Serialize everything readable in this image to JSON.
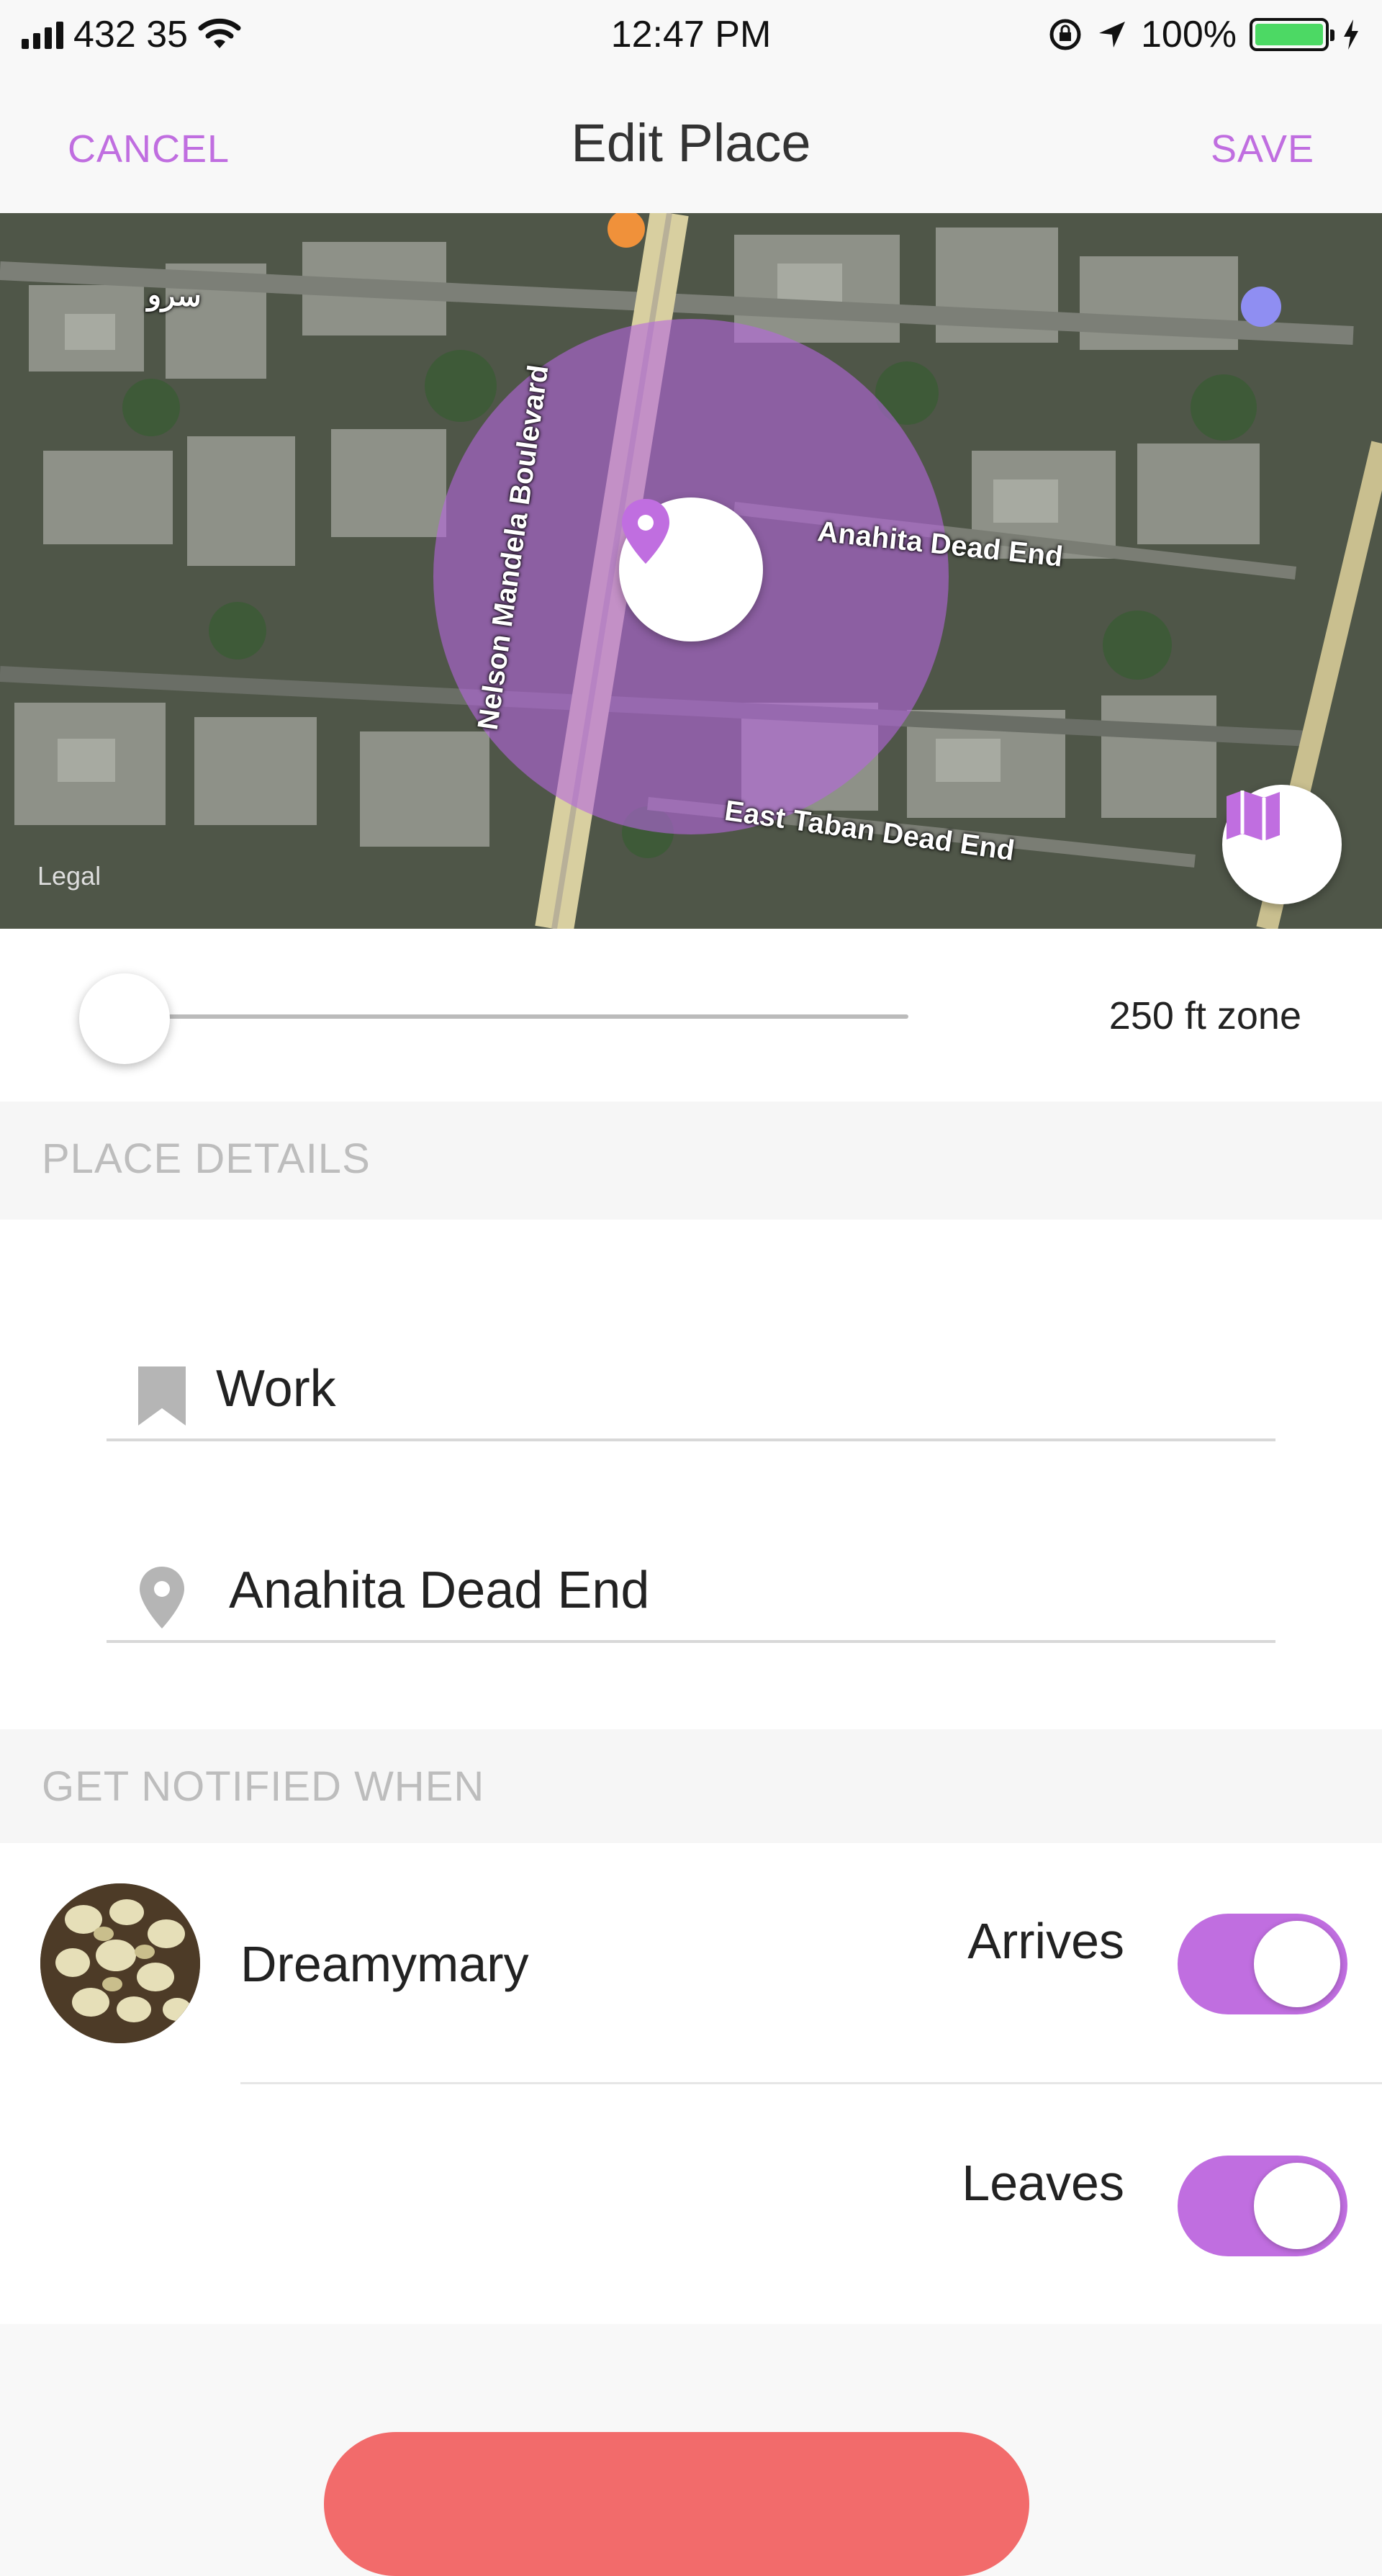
{
  "status_bar": {
    "carrier": "432 35",
    "time": "12:47 PM",
    "battery": "100%"
  },
  "nav": {
    "cancel": "CANCEL",
    "title": "Edit Place",
    "save": "SAVE"
  },
  "map": {
    "streets": [
      "سرو",
      "Nelson Mandela Boulevard",
      "Anahita Dead End",
      "East Taban Dead End"
    ],
    "legal": "Legal"
  },
  "radius": {
    "label": "250 ft zone",
    "slider_fraction": 0.0
  },
  "place_details": {
    "header": "PLACE DETAILS",
    "name": "Work",
    "address": "Anahita Dead End"
  },
  "notifications": {
    "header": "GET NOTIFIED WHEN",
    "person": "Dreamymary",
    "arrives_label": "Arrives",
    "arrives_on": true,
    "leaves_label": "Leaves",
    "leaves_on": true
  },
  "colors": {
    "accent": "#c06ee0",
    "bottom_button": "#f26b6b"
  },
  "icons": [
    "signal-icon",
    "wifi-icon",
    "rotation-lock-icon",
    "location-arrow-icon",
    "battery-icon",
    "charging-icon",
    "map-pin-icon",
    "map-icon",
    "bookmark-icon",
    "location-pin-icon"
  ]
}
